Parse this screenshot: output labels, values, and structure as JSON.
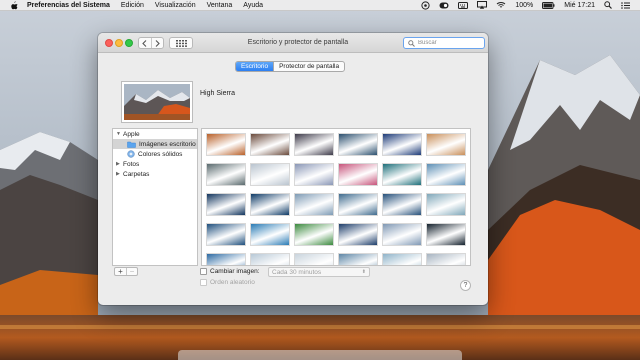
{
  "menubar": {
    "app_name": "Preferencias del Sistema",
    "items": [
      "Edición",
      "Visualización",
      "Ventana",
      "Ayuda"
    ],
    "battery": "100%",
    "clock": "Mié 17:21",
    "status_icons": [
      "siri-icon",
      "eye-icon",
      "keyboard-icon",
      "airplay-icon",
      "wifi-icon",
      "battery-icon",
      "spotlight-icon",
      "list-icon"
    ]
  },
  "window": {
    "title": "Escritorio y protector de pantalla",
    "search_placeholder": "Buscar",
    "tabs": [
      {
        "label": "Escritorio",
        "active": true
      },
      {
        "label": "Protector de pantalla",
        "active": false
      }
    ],
    "current_wallpaper": "High Sierra",
    "sidebar": [
      {
        "label": "Apple",
        "level": 0,
        "expanded": true,
        "icon": ""
      },
      {
        "label": "Imágenes escritorio",
        "level": 1,
        "selected": true,
        "icon": "folder-icon"
      },
      {
        "label": "Colores sólidos",
        "level": 1,
        "selected": false,
        "icon": "color-wheel-icon"
      },
      {
        "label": "Fotos",
        "level": 0,
        "expanded": false,
        "icon": ""
      },
      {
        "label": "Carpetas",
        "level": 0,
        "expanded": false,
        "icon": ""
      }
    ],
    "change_picture_label": "Cambiar imagen:",
    "change_picture_interval": "Cada 30 minutos",
    "random_order_label": "Orden aleatorio",
    "help_label": "?",
    "add_label": "+",
    "remove_label": "−"
  },
  "thumbnails": [
    [
      "#b9612a",
      "#6a4a3c",
      "#3e3b4a",
      "#2b4f6e",
      "#1d3b78",
      "#c98f5a"
    ],
    [
      "#5a6a6e",
      "#b9c4cf",
      "#8a97b6",
      "#c7547b",
      "#1e6f7a",
      "#5d8fb5"
    ],
    [
      "#12355e",
      "#0e3a66",
      "#7e9bb5",
      "#3f6b8e",
      "#26507a",
      "#7fa7b9"
    ],
    [
      "#1f4f7d",
      "#2a7bb5",
      "#3c8a3f",
      "#1d3d6a",
      "#7f98b4",
      "#14212d"
    ],
    [
      "#2d6aa3",
      "#b7c8d6",
      "#c9d4dd",
      "#5e86a6",
      "#8fb3c9",
      "#a7b4c1"
    ]
  ]
}
